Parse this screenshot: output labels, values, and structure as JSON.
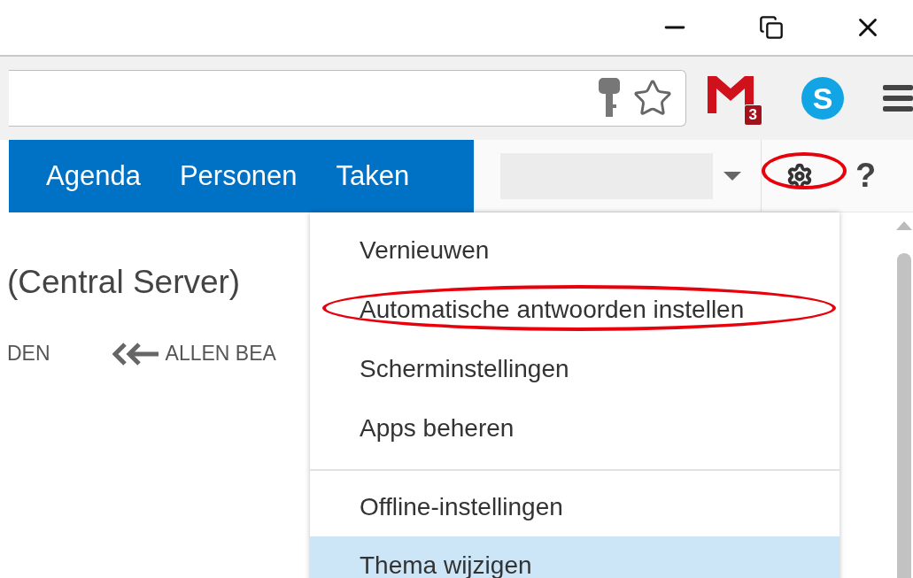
{
  "browser": {
    "extensions": [
      {
        "kind": "mail",
        "badge": "3"
      },
      {
        "kind": "skype",
        "letter": "S"
      }
    ]
  },
  "nav": {
    "tabs": [
      {
        "label": "Agenda"
      },
      {
        "label": "Personen"
      },
      {
        "label": "Taken"
      }
    ],
    "settings": {
      "circled": true
    },
    "help": "?"
  },
  "content": {
    "heading": "(Central Server)",
    "links": [
      {
        "label": "DEN",
        "kind": "plain"
      },
      {
        "label": "ALLEN BEA",
        "kind": "back"
      }
    ]
  },
  "menu": {
    "sections": [
      [
        {
          "label": "Vernieuwen",
          "selected": false,
          "circled": false
        },
        {
          "label": "Automatische antwoorden instellen",
          "selected": false,
          "circled": true
        },
        {
          "label": "Scherminstellingen",
          "selected": false,
          "circled": false
        },
        {
          "label": "Apps beheren",
          "selected": false,
          "circled": false
        }
      ],
      [
        {
          "label": "Offline-instellingen",
          "selected": false,
          "circled": false
        },
        {
          "label": "Thema wijzigen",
          "selected": true,
          "circled": false
        }
      ]
    ]
  }
}
